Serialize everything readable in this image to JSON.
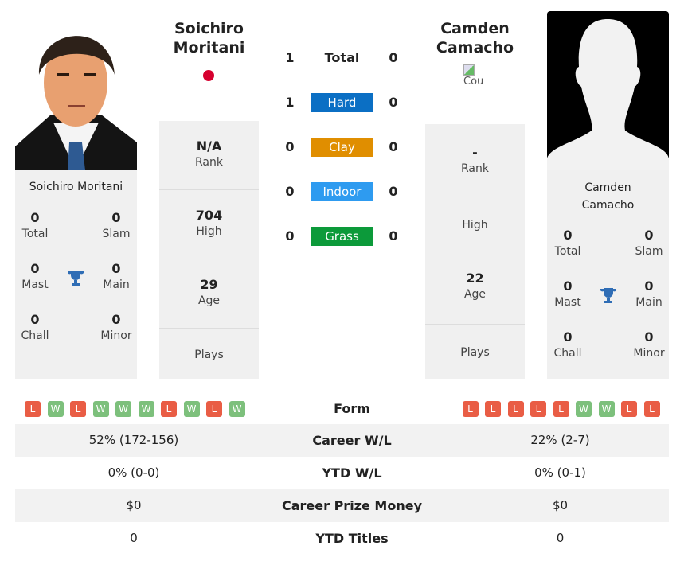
{
  "player1": {
    "name": "Soichiro Moritani",
    "name_lines": [
      "Soichiro",
      "Moritani"
    ],
    "flag_color": "#d6002f",
    "stats": {
      "total": "0",
      "slam": "0",
      "mast": "0",
      "main": "0",
      "chall": "0",
      "minor": "0"
    },
    "rank": "N/A",
    "high": "704",
    "age": "29",
    "plays": ""
  },
  "player2": {
    "name": "Camden Camacho",
    "name_lines": [
      "Camden",
      "Camacho"
    ],
    "flag_alt": "Cou",
    "stats": {
      "total": "0",
      "slam": "0",
      "mast": "0",
      "main": "0",
      "chall": "0",
      "minor": "0"
    },
    "rank": "-",
    "high": "",
    "age": "22",
    "plays": ""
  },
  "labels": {
    "total": "Total",
    "slam": "Slam",
    "mast": "Mast",
    "main": "Main",
    "chall": "Chall",
    "minor": "Minor",
    "rank": "Rank",
    "high": "High",
    "age": "Age",
    "plays": "Plays"
  },
  "h2h": [
    {
      "label": "Total",
      "p1": "1",
      "p2": "0",
      "color": ""
    },
    {
      "label": "Hard",
      "p1": "1",
      "p2": "0",
      "color": "#0b6fc4"
    },
    {
      "label": "Clay",
      "p1": "0",
      "p2": "0",
      "color": "#e08e00"
    },
    {
      "label": "Indoor",
      "p1": "0",
      "p2": "0",
      "color": "#2e9bf0"
    },
    {
      "label": "Grass",
      "p1": "0",
      "p2": "0",
      "color": "#0c9a3a"
    }
  ],
  "form": {
    "label": "Form",
    "p1": [
      "L",
      "W",
      "L",
      "W",
      "W",
      "W",
      "L",
      "W",
      "L",
      "W"
    ],
    "p2": [
      "L",
      "L",
      "L",
      "L",
      "L",
      "W",
      "W",
      "L",
      "L"
    ]
  },
  "table": [
    {
      "label": "Career W/L",
      "p1": "52% (172-156)",
      "p2": "22% (2-7)"
    },
    {
      "label": "YTD W/L",
      "p1": "0% (0-0)",
      "p2": "0% (0-1)"
    },
    {
      "label": "Career Prize Money",
      "p1": "$0",
      "p2": "$0"
    },
    {
      "label": "YTD Titles",
      "p1": "0",
      "p2": "0"
    }
  ]
}
